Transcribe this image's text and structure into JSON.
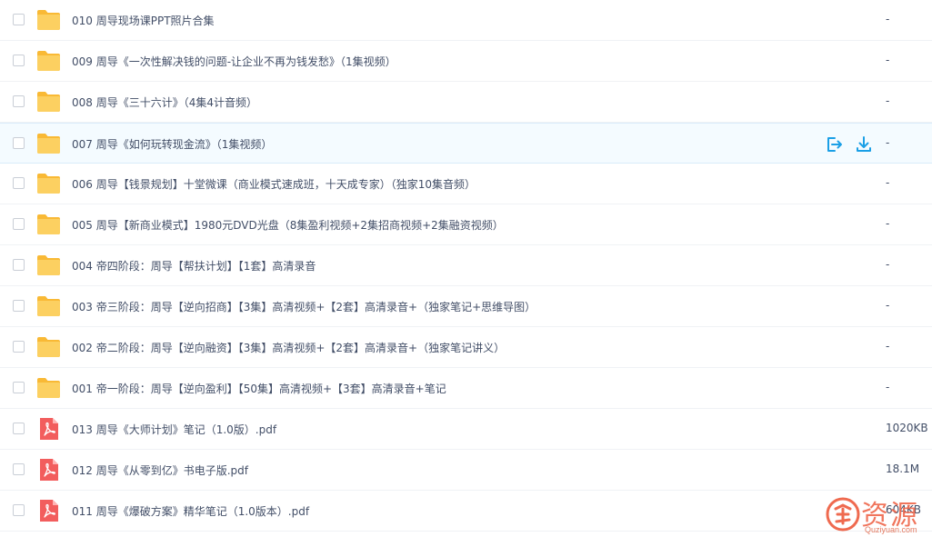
{
  "files": [
    {
      "type": "folder",
      "name": "010 周导现场课PPT照片合集",
      "size": "-"
    },
    {
      "type": "folder",
      "name": "009 周导《一次性解决钱的问题-让企业不再为钱发愁》（1集视频）",
      "size": "-"
    },
    {
      "type": "folder",
      "name": "008 周导《三十六计》（4集4计音频）",
      "size": "-"
    },
    {
      "type": "folder",
      "name": "007 周导《如何玩转现金流》（1集视频）",
      "size": "-",
      "hovered": true
    },
    {
      "type": "folder",
      "name": "006 周导【钱景规划】十堂微课（商业模式速成班，十天成专家）（独家10集音频）",
      "size": "-"
    },
    {
      "type": "folder",
      "name": "005 周导【新商业模式】1980元DVD光盘（8集盈利视频+2集招商视频+2集融资视频）",
      "size": "-"
    },
    {
      "type": "folder",
      "name": "004 帝四阶段：周导【帮扶计划】【1套】高清录音",
      "size": "-"
    },
    {
      "type": "folder",
      "name": "003 帝三阶段：周导【逆向招商】【3集】高清视频+【2套】高清录音+（独家笔记+思维导图）",
      "size": "-"
    },
    {
      "type": "folder",
      "name": "002 帝二阶段：周导【逆向融资】【3集】高清视频+【2套】高清录音+（独家笔记讲义）",
      "size": "-"
    },
    {
      "type": "folder",
      "name": "001 帝一阶段：周导【逆向盈利】【50集】高清视频+【3套】高清录音+笔记",
      "size": "-"
    },
    {
      "type": "pdf",
      "name": "013 周导《大师计划》笔记（1.0版）.pdf",
      "size": "1020KB"
    },
    {
      "type": "pdf",
      "name": "012 周导《从零到亿》书电子版.pdf",
      "size": "18.1M"
    },
    {
      "type": "pdf",
      "name": "011 周导《爆破方案》精华笔记（1.0版本）.pdf",
      "size": "604KB"
    }
  ],
  "icons": {
    "folder": "folder-icon",
    "pdf": "pdf-file-icon",
    "share": "share-icon",
    "download": "download-icon"
  },
  "colors": {
    "folder": "#fcc44a",
    "pdf": "#f25d5d",
    "accent": "#1a9fe6",
    "text": "#424e67",
    "row_hover": "#f4fbff",
    "watermark": "#ef6a4f"
  },
  "watermark": {
    "text": "资源",
    "subtext": "Quziyuan.com"
  }
}
